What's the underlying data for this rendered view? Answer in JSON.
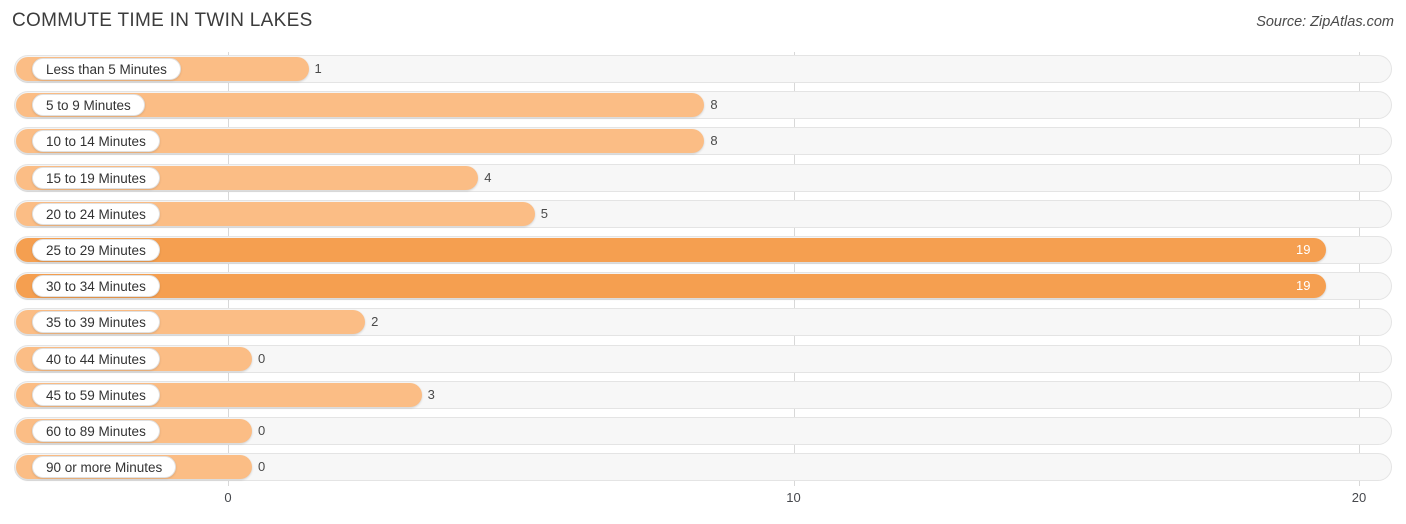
{
  "header": {
    "title": "COMMUTE TIME IN TWIN LAKES",
    "source": "Source: ZipAtlas.com"
  },
  "colors": {
    "bar_light": "#fbbd85",
    "bar_dark": "#f59f50",
    "track": "#f7f7f7",
    "gridline": "#d8d8d8",
    "label_text": "#333333",
    "value_text": "#4a4a4a",
    "value_text_inside": "#ffffff"
  },
  "axis": {
    "ticks": [
      "0",
      "10",
      "20"
    ],
    "tick_values": [
      0,
      10,
      20
    ],
    "min": 0,
    "max": 20
  },
  "chart_data": {
    "type": "bar",
    "orientation": "horizontal",
    "title": "COMMUTE TIME IN TWIN LAKES",
    "subtitle": "",
    "xlabel": "",
    "ylabel": "",
    "xlim": [
      0,
      20
    ],
    "grid": true,
    "legend": null,
    "source": "Source: ZipAtlas.com",
    "categories": [
      "Less than 5 Minutes",
      "5 to 9 Minutes",
      "10 to 14 Minutes",
      "15 to 19 Minutes",
      "20 to 24 Minutes",
      "25 to 29 Minutes",
      "30 to 34 Minutes",
      "35 to 39 Minutes",
      "40 to 44 Minutes",
      "45 to 59 Minutes",
      "60 to 89 Minutes",
      "90 or more Minutes"
    ],
    "values": [
      1,
      8,
      8,
      4,
      5,
      19,
      19,
      2,
      0,
      3,
      0,
      0
    ],
    "value_labels": [
      "1",
      "8",
      "8",
      "4",
      "5",
      "19",
      "19",
      "2",
      "0",
      "3",
      "0",
      "0"
    ]
  },
  "rows": [
    {
      "label": "Less than 5 Minutes",
      "value": 1,
      "value_label": "1",
      "tone": "light",
      "inside": false
    },
    {
      "label": "5 to 9 Minutes",
      "value": 8,
      "value_label": "8",
      "tone": "light",
      "inside": false
    },
    {
      "label": "10 to 14 Minutes",
      "value": 8,
      "value_label": "8",
      "tone": "light",
      "inside": false
    },
    {
      "label": "15 to 19 Minutes",
      "value": 4,
      "value_label": "4",
      "tone": "light",
      "inside": false
    },
    {
      "label": "20 to 24 Minutes",
      "value": 5,
      "value_label": "5",
      "tone": "light",
      "inside": false
    },
    {
      "label": "25 to 29 Minutes",
      "value": 19,
      "value_label": "19",
      "tone": "dark",
      "inside": true
    },
    {
      "label": "30 to 34 Minutes",
      "value": 19,
      "value_label": "19",
      "tone": "dark",
      "inside": true
    },
    {
      "label": "35 to 39 Minutes",
      "value": 2,
      "value_label": "2",
      "tone": "light",
      "inside": false
    },
    {
      "label": "40 to 44 Minutes",
      "value": 0,
      "value_label": "0",
      "tone": "light",
      "inside": false
    },
    {
      "label": "45 to 59 Minutes",
      "value": 3,
      "value_label": "3",
      "tone": "light",
      "inside": false
    },
    {
      "label": "60 to 89 Minutes",
      "value": 0,
      "value_label": "0",
      "tone": "light",
      "inside": false
    },
    {
      "label": "90 or more Minutes",
      "value": 0,
      "value_label": "0",
      "tone": "light",
      "inside": false
    }
  ]
}
